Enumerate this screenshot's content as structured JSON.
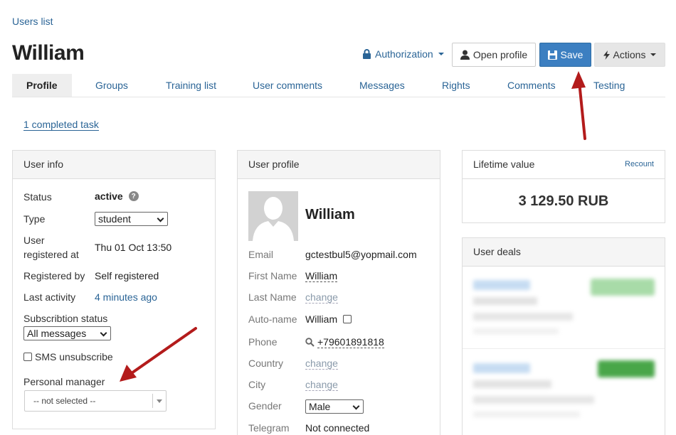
{
  "breadcrumb": "Users list",
  "title": "William",
  "header": {
    "authorization": "Authorization",
    "open_profile": "Open profile",
    "save": "Save",
    "actions": "Actions"
  },
  "tabs": [
    "Profile",
    "Groups",
    "Training list",
    "User comments",
    "Messages",
    "Rights",
    "Comments",
    "Testing"
  ],
  "completed_task": "1 completed task",
  "user_info": {
    "heading": "User info",
    "status_label": "Status",
    "status_value": "active",
    "type_label": "Type",
    "type_value": "student",
    "registered_at_label_1": "User",
    "registered_at_label_2": "registered at",
    "registered_at_value": "Thu 01 Oct 13:50",
    "registered_by_label": "Registered by",
    "registered_by_value": "Self registered",
    "last_activity_label": "Last activity",
    "last_activity_value": "4 minutes ago",
    "subscription_label": "Subscribtion status",
    "subscription_value": "All messages",
    "sms_unsubscribe": "SMS unsubscribe",
    "manager_label": "Personal manager",
    "manager_value": "-- not selected --"
  },
  "user_profile": {
    "heading": "User profile",
    "name": "William",
    "email_label": "Email",
    "email_value": "gctestbul5@yopmail.com",
    "first_name_label": "First Name",
    "first_name_value": "William",
    "last_name_label": "Last Name",
    "change": "change",
    "auto_name_label": "Auto-name",
    "auto_name_value": "William",
    "phone_label": "Phone",
    "phone_value": "+79601891818",
    "country_label": "Country",
    "city_label": "City",
    "gender_label": "Gender",
    "gender_value": "Male",
    "telegram_label": "Telegram",
    "telegram_value": "Not connected"
  },
  "lifetime": {
    "heading": "Lifetime value",
    "recount": "Recount",
    "value": "3 129.50 RUB"
  },
  "deals": {
    "heading": "User deals"
  },
  "colors": {
    "link": "#2a6496",
    "primary": "#3c7fc1",
    "arrow": "#b31b1b",
    "badge_green": "#5cb85c"
  }
}
